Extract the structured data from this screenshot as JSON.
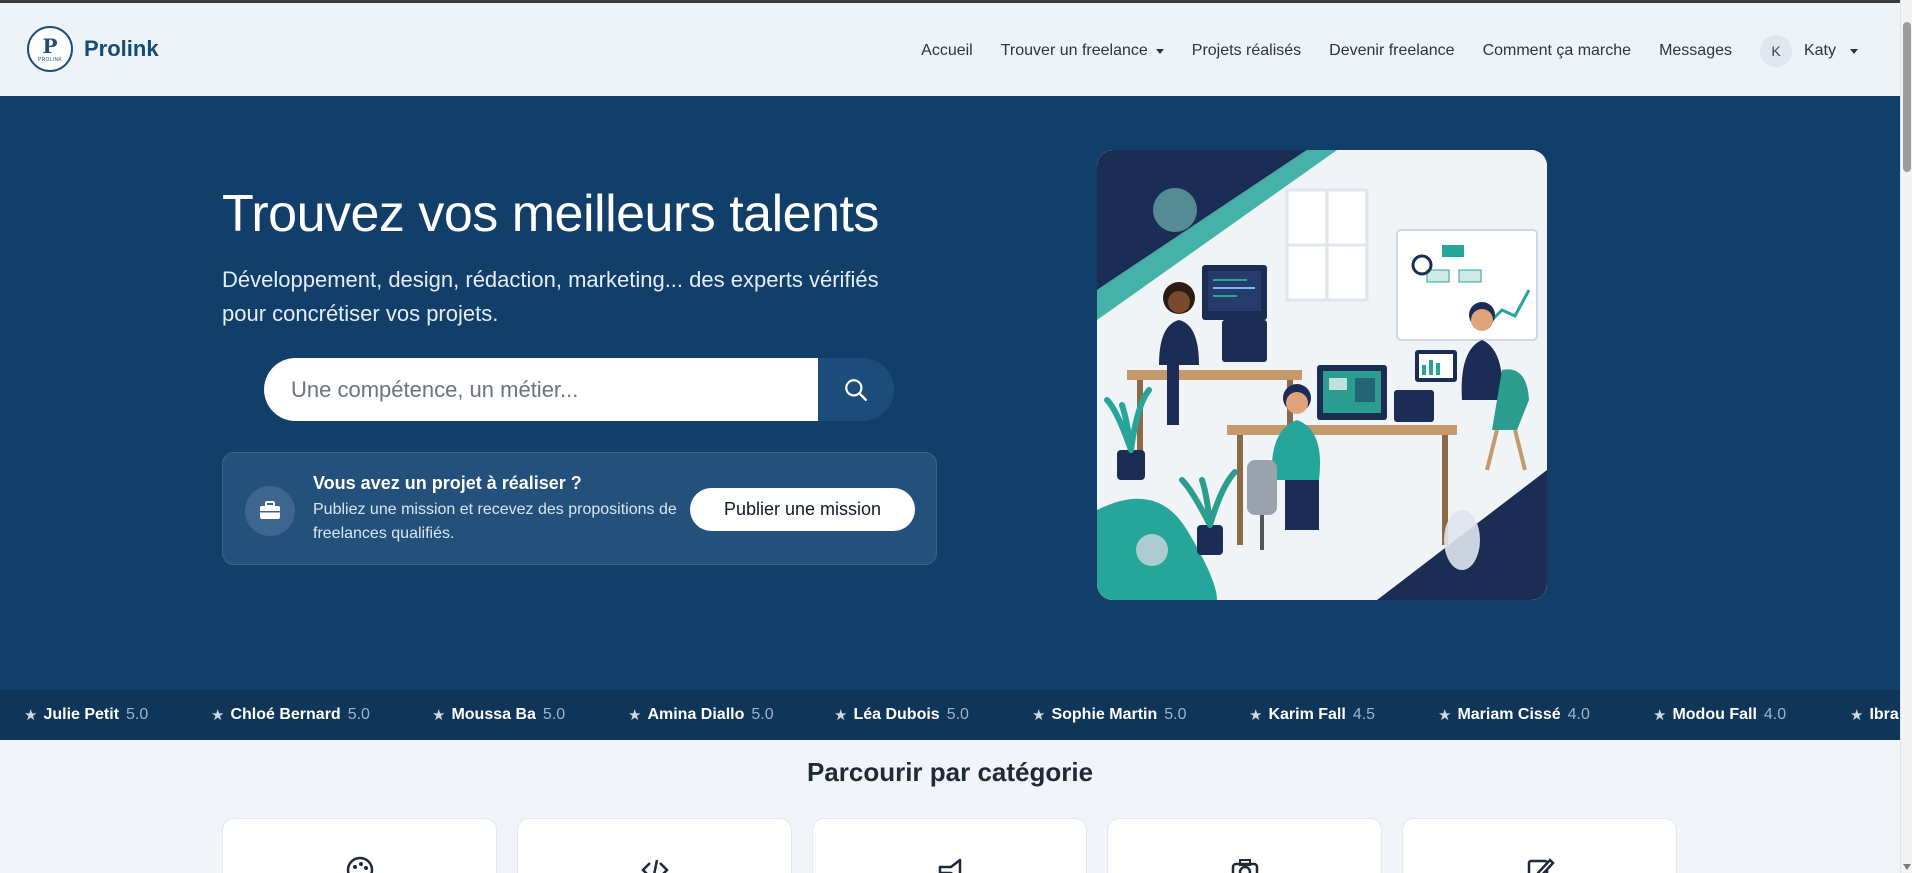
{
  "brand": {
    "name": "Prolink",
    "logo_letter": "P",
    "logo_text": "PROLINK"
  },
  "nav": {
    "items": [
      {
        "label": "Accueil",
        "dropdown": false
      },
      {
        "label": "Trouver un freelance",
        "dropdown": true
      },
      {
        "label": "Projets réalisés",
        "dropdown": false
      },
      {
        "label": "Devenir freelance",
        "dropdown": false
      },
      {
        "label": "Comment ça marche",
        "dropdown": false
      },
      {
        "label": "Messages",
        "dropdown": false
      }
    ],
    "user": {
      "initial": "K",
      "name": "Katy"
    }
  },
  "hero": {
    "title": "Trouvez vos meilleurs talents",
    "subtitle": "Développement, design, rédaction, marketing... des experts vérifiés pour concrétiser vos projets.",
    "search": {
      "placeholder": "Une compétence, un métier..."
    },
    "cta": {
      "title": "Vous avez un projet à réaliser ?",
      "text": "Publiez une mission et recevez des propositions de freelances qualifiés.",
      "button": "Publier une mission"
    }
  },
  "ticker": [
    {
      "name": "Julie Petit",
      "rating": "5.0"
    },
    {
      "name": "Chloé Bernard",
      "rating": "5.0"
    },
    {
      "name": "Moussa Ba",
      "rating": "5.0"
    },
    {
      "name": "Amina Diallo",
      "rating": "5.0"
    },
    {
      "name": "Léa Dubois",
      "rating": "5.0"
    },
    {
      "name": "Sophie Martin",
      "rating": "5.0"
    },
    {
      "name": "Karim Fall",
      "rating": "4.5"
    },
    {
      "name": "Mariam Cissé",
      "rating": "4.0"
    },
    {
      "name": "Modou Fall",
      "rating": "4.0"
    },
    {
      "name": "Ibra",
      "rating": ""
    }
  ],
  "categories": {
    "title": "Parcourir par catégorie",
    "icons": [
      "palette-icon",
      "code-icon",
      "megaphone-icon",
      "camera-icon",
      "pen-icon"
    ]
  },
  "colors": {
    "hero_bg": "#123f6a",
    "ticker_bg": "#0f3558",
    "navbar_bg": "#eef3f8",
    "accent": "#1c4d7a",
    "teal": "#2a9d8f"
  }
}
